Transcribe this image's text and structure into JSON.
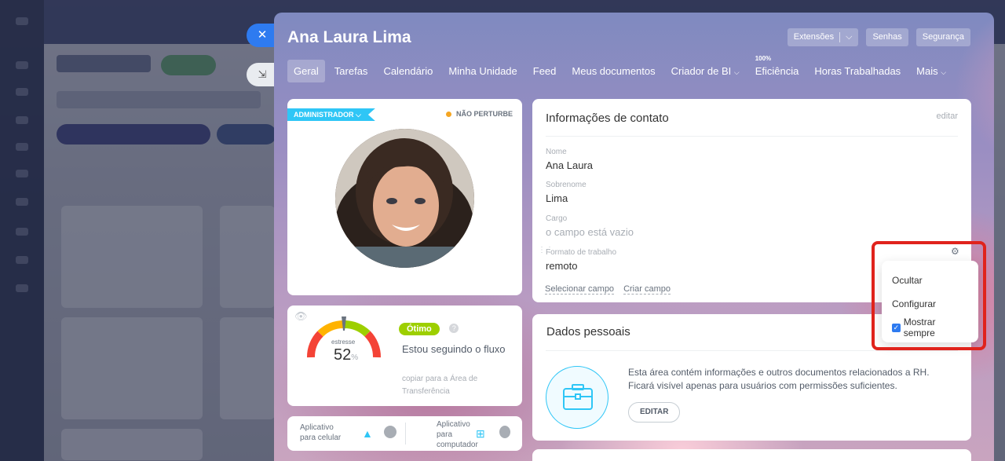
{
  "header": {
    "title": "Ana Laura Lima",
    "buttons": [
      "Extensões",
      "Senhas",
      "Segurança"
    ]
  },
  "tabs": [
    {
      "label": "Geral",
      "active": true
    },
    {
      "label": "Tarefas"
    },
    {
      "label": "Calendário"
    },
    {
      "label": "Minha Unidade"
    },
    {
      "label": "Feed"
    },
    {
      "label": "Meus documentos"
    },
    {
      "label": "Criador de BI",
      "dropdown": true
    },
    {
      "label": "Eficiência",
      "badge": "100%"
    },
    {
      "label": "Horas Trabalhadas"
    },
    {
      "label": "Mais",
      "dropdown": true
    }
  ],
  "profile": {
    "role_badge": "ADMINISTRADOR",
    "status": "NÃO PERTURBE"
  },
  "stress": {
    "label": "estresse",
    "value": "52",
    "unit": "%",
    "level": 0.52,
    "badge": "Ótimo",
    "text": "Estou seguindo o fluxo",
    "copy_link": "copiar para a Área de Transferência"
  },
  "apps": {
    "mobile": "Aplicativo para celular",
    "desktop": "Aplicativo para computador"
  },
  "contact": {
    "title": "Informações de contato",
    "edit": "editar",
    "fields": [
      {
        "label": "Nome",
        "value": "Ana Laura"
      },
      {
        "label": "Sobrenome",
        "value": "Lima"
      },
      {
        "label": "Cargo",
        "value": "o campo está vazio"
      },
      {
        "label": "Formato de trabalho",
        "value": "remoto"
      }
    ],
    "select_field": "Selecionar campo",
    "create_field": "Criar campo"
  },
  "context_menu": {
    "items": [
      "Ocultar",
      "Configurar"
    ],
    "checkbox_label": "Mostrar sempre",
    "checked": true
  },
  "personal": {
    "title": "Dados pessoais",
    "text1": "Esta área contém informações e outros documentos relacionados a RH.",
    "text2": "Ficará visível apenas para usuários com permissões suficientes.",
    "button": "EDITAR"
  },
  "colors": {
    "accent": "#2e7bf0",
    "badge": "#2fc6f6",
    "ok": "#9dcf00",
    "highlight": "#e0231c"
  }
}
